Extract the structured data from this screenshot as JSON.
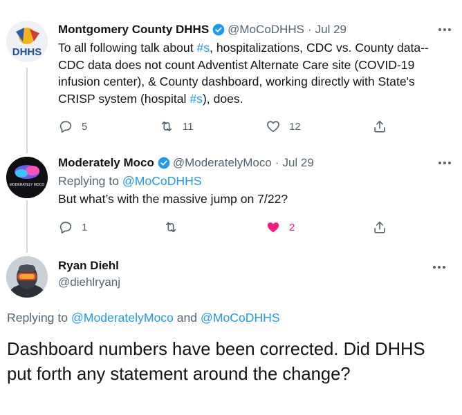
{
  "tweets": [
    {
      "name": "Montgomery County DHHS",
      "handle": "@MoCoDHHS",
      "date": "Jul 29",
      "text_parts": [
        "To all following talk about ",
        "#s",
        ", hospitalizations, CDC vs. County data-- CDC data does not count Adventist Alternate Care site (COVID-19 infusion center), & County dashboard, working directly with State's CRISP system (hospital ",
        "#s",
        "), does."
      ],
      "replies": "5",
      "retweets": "11",
      "likes": "12",
      "avatar_text": "DHHS"
    },
    {
      "name": "Moderately Moco",
      "handle": "@ModeratelyMoco",
      "date": "Jul 29",
      "replying_prefix": "Replying to ",
      "replying_to": "@MoCoDHHS",
      "text": "But what’s with the massive jump on 7/22?",
      "replies": "1",
      "retweets": "",
      "likes": "2",
      "avatar_text": "MODERATELY MOCO"
    }
  ],
  "main": {
    "name": "Ryan Diehl",
    "handle": "@diehlryanj",
    "replying_prefix": "Replying to ",
    "replying_to_1": "@ModeratelyMoco",
    "replying_and": " and ",
    "replying_to_2": "@MoCoDHHS",
    "text": "Dashboard numbers have been corrected.  Did DHHS put forth any statement around the change?"
  },
  "colors": {
    "link": "#1d9bf0",
    "secondary": "#536471",
    "like": "#f91880",
    "verified": "#1d9bf0"
  },
  "icons": [
    "verified-icon",
    "more-icon",
    "reply-icon",
    "retweet-icon",
    "like-icon",
    "share-icon"
  ]
}
